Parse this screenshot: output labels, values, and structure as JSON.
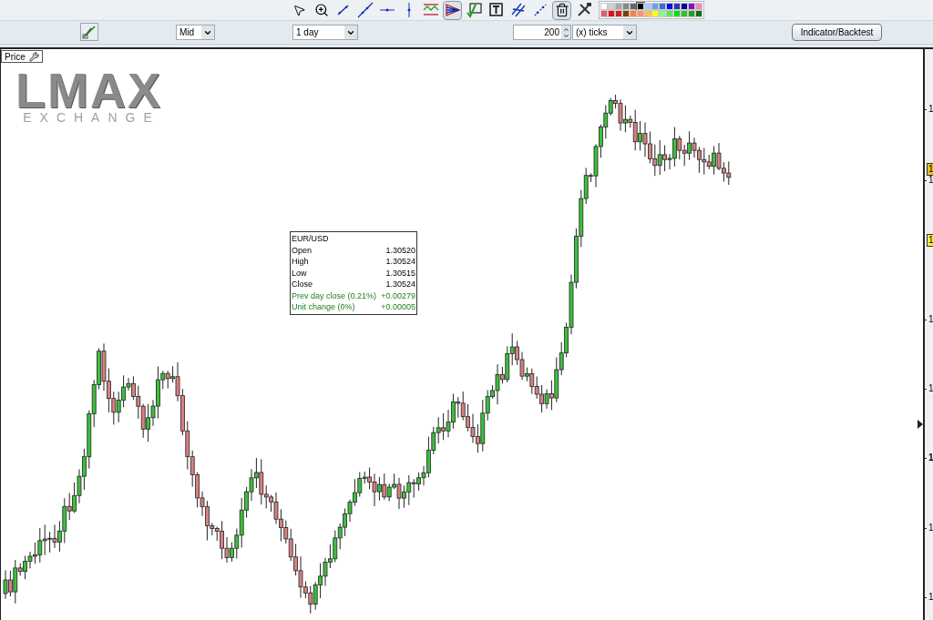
{
  "toolbar": {
    "tools": [
      {
        "selected": false
      },
      {
        "selected": false
      },
      {
        "selected": false
      },
      {
        "selected": false
      },
      {
        "selected": false
      },
      {
        "selected": false
      },
      {
        "selected": false
      },
      {
        "selected": true
      },
      {
        "selected": false
      },
      {
        "selected": false
      },
      {
        "selected": false
      },
      {
        "selected": false
      },
      {
        "selected": true
      },
      {
        "selected": false
      }
    ],
    "palette": [
      {
        "color": "#ffffff",
        "selected": false
      },
      {
        "color": "#d0d0d0",
        "selected": false
      },
      {
        "color": "#a8a8a8",
        "selected": false
      },
      {
        "color": "#888888",
        "selected": false
      },
      {
        "color": "#666666",
        "selected": false
      },
      {
        "color": "#000000",
        "selected": true
      },
      {
        "color": "#a8c8ff",
        "selected": false
      },
      {
        "color": "#60a0f0",
        "selected": false
      },
      {
        "color": "#3070e0",
        "selected": false
      },
      {
        "color": "#0010e0",
        "selected": false
      },
      {
        "color": "#3030c0",
        "selected": false
      },
      {
        "color": "#000090",
        "selected": false
      },
      {
        "color": "#8010c0",
        "selected": false
      },
      {
        "color": "#ff80c0",
        "selected": false
      },
      {
        "color": "#e06060",
        "selected": false
      },
      {
        "color": "#e01010",
        "selected": false
      },
      {
        "color": "#d02020",
        "selected": false
      },
      {
        "color": "#804000",
        "selected": false
      },
      {
        "color": "#ff8040",
        "selected": false
      },
      {
        "color": "#ff9070",
        "selected": false
      },
      {
        "color": "#ffc040",
        "selected": false
      },
      {
        "color": "#ffff00",
        "selected": false
      },
      {
        "color": "#80ff80",
        "selected": false
      },
      {
        "color": "#60e060",
        "selected": false
      },
      {
        "color": "#00e000",
        "selected": false
      },
      {
        "color": "#30c030",
        "selected": false
      },
      {
        "color": "#20a020",
        "selected": false
      },
      {
        "color": "#107010",
        "selected": false
      }
    ]
  },
  "controls": {
    "price_type": "Mid",
    "period": "1 day",
    "count": "200",
    "unit": "(x) ticks",
    "indicator_button": "Indicator/Backtest"
  },
  "chart": {
    "panel_label": "Price",
    "logo": {
      "wordmark": "LMAX",
      "tagline": "EXCHANGE"
    },
    "axis_labels": [
      {
        "text": "1",
        "bold": false
      },
      {
        "text": "1",
        "bold": false
      },
      {
        "text": "1",
        "bold": false
      },
      {
        "text": "1",
        "bold": false
      },
      {
        "text": "1",
        "bold": true
      },
      {
        "text": "1",
        "bold": false
      },
      {
        "text": "1",
        "bold": false
      }
    ],
    "price_tags": [
      {
        "text": "1",
        "color": "#f0c020"
      },
      {
        "text": "1",
        "color": "#f8f040"
      }
    ],
    "tooltip": {
      "title": "EUR/USD",
      "rows": [
        {
          "label": "Open",
          "value": "1.30520",
          "kind": "plain"
        },
        {
          "label": "High",
          "value": "1.30524",
          "kind": "plain"
        },
        {
          "label": "Low",
          "value": "1.30515",
          "kind": "plain"
        },
        {
          "label": "Close",
          "value": "1.30524",
          "kind": "plain"
        },
        {
          "label": "Prev day close (0.21%)",
          "value": "+0.00279",
          "kind": "change"
        },
        {
          "label": "Unit change (0%)",
          "value": "+0.00005",
          "kind": "change"
        }
      ]
    }
  }
}
